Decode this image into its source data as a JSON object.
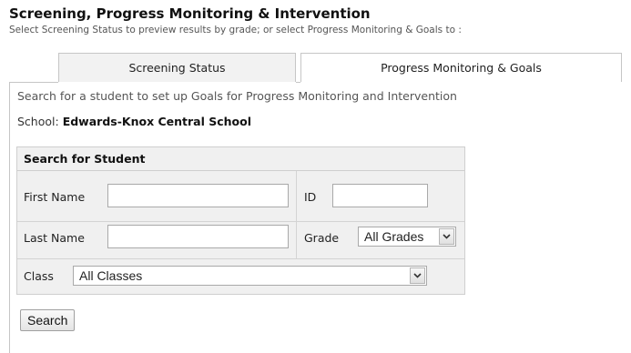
{
  "header": {
    "title": "Screening, Progress Monitoring & Intervention",
    "subtitle": "Select Screening Status to preview results by grade; or select Progress Monitoring & Goals to :"
  },
  "tabs": [
    {
      "label": "Screening Status",
      "active": false
    },
    {
      "label": "Progress Monitoring & Goals",
      "active": true
    }
  ],
  "intro_text": "Search for a student to set up Goals for Progress Monitoring and Intervention",
  "school": {
    "label": "School: ",
    "name": "Edwards-Knox Central School"
  },
  "search_form": {
    "heading": "Search for Student",
    "first_name_label": "First Name",
    "first_name_value": "",
    "id_label": "ID",
    "id_value": "",
    "last_name_label": "Last Name",
    "last_name_value": "",
    "grade_label": "Grade",
    "grade_selected": "All Grades",
    "class_label": "Class",
    "class_selected": "All Classes",
    "submit_label": "Search"
  },
  "icons": {
    "dropdown": "chevron-down-icon"
  }
}
